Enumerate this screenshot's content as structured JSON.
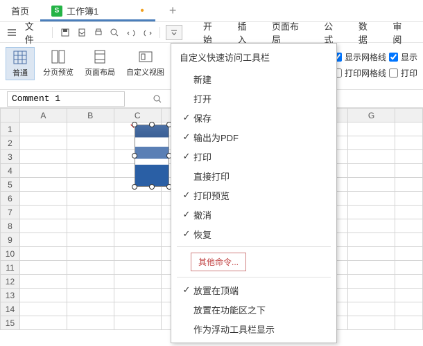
{
  "tabs": {
    "home": "首页",
    "workbook": "工作簿1",
    "plus": "+"
  },
  "menubar": {
    "file": "文件",
    "ribbon_tabs": [
      "开始",
      "插入",
      "页面布局",
      "公式",
      "数据",
      "审阅"
    ]
  },
  "ribbon": {
    "normal": "普通",
    "page_break": "分页预览",
    "page_layout": "页面布局",
    "custom_view": "自定义视图",
    "show_grid_label": "显示网格线",
    "show_label2": "显示",
    "print_grid_label": "打印网格线",
    "print_label2": "打印"
  },
  "namebox": {
    "value": "Comment 1"
  },
  "columns": [
    "A",
    "B",
    "C",
    "",
    "G",
    ""
  ],
  "rows": [
    "1",
    "2",
    "3",
    "4",
    "5",
    "6",
    "7",
    "8",
    "9",
    "10",
    "11",
    "12",
    "13",
    "14",
    "15"
  ],
  "dropdown": {
    "title": "自定义快速访问工具栏",
    "items": [
      {
        "label": "新建",
        "checked": false
      },
      {
        "label": "打开",
        "checked": false
      },
      {
        "label": "保存",
        "checked": true
      },
      {
        "label": "输出为PDF",
        "checked": true
      },
      {
        "label": "打印",
        "checked": true
      },
      {
        "label": "直接打印",
        "checked": false
      },
      {
        "label": "打印预览",
        "checked": true
      },
      {
        "label": "撤消",
        "checked": true
      },
      {
        "label": "恢复",
        "checked": true
      }
    ],
    "other": "其他命令...",
    "items2": [
      {
        "label": "放置在顶端",
        "checked": true
      },
      {
        "label": "放置在功能区之下",
        "checked": false
      },
      {
        "label": "作为浮动工具栏显示",
        "checked": false
      }
    ]
  }
}
